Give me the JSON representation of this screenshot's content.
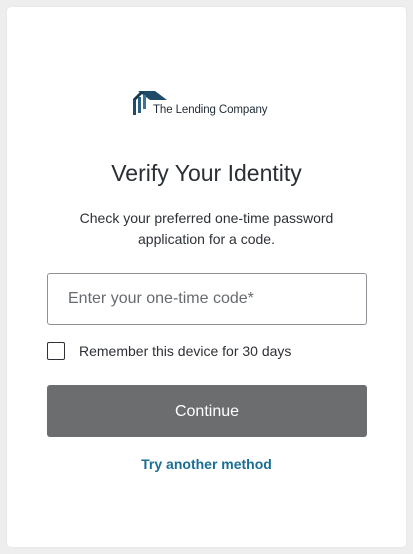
{
  "brand": {
    "logo_text": "The Lending Company",
    "logo_icon": "house-logo-icon",
    "logo_color": "#1f4a68"
  },
  "main": {
    "title": "Verify Your Identity",
    "subtitle": "Check your preferred one-time password application for a code."
  },
  "otp_field": {
    "value": "",
    "placeholder": "Enter your one-time code*"
  },
  "remember": {
    "label": "Remember this device for 30 days",
    "checked": false
  },
  "actions": {
    "continue_label": "Continue",
    "continue_color": "#6c6d6f",
    "try_another_label": "Try another method",
    "link_color": "#1a6e96"
  }
}
